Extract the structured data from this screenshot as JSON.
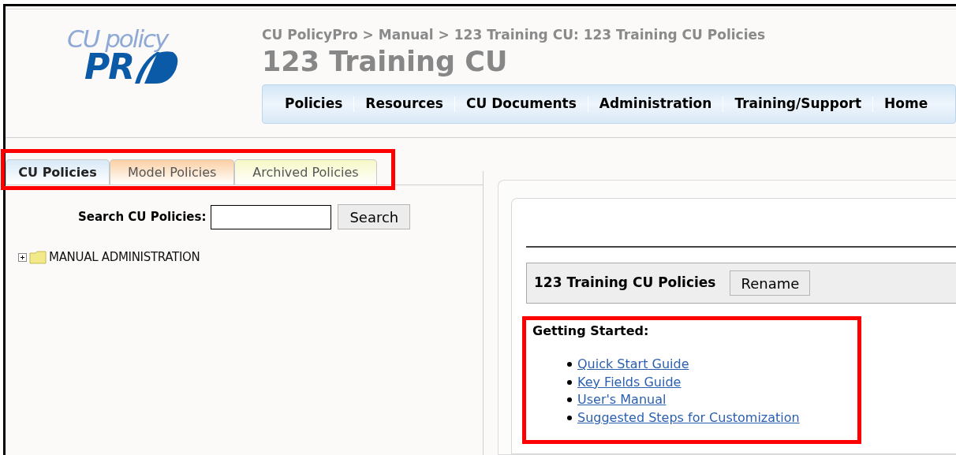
{
  "logo": {
    "top": "CU policy",
    "bottom": "PR"
  },
  "breadcrumb": "CU PolicyPro > Manual > 123 Training CU: 123 Training CU Policies",
  "title": "123 Training CU",
  "nav": [
    "Policies",
    "Resources",
    "CU Documents",
    "Administration",
    "Training/Support",
    "Home"
  ],
  "tabs_highlighted": true,
  "tabs": [
    {
      "label": "CU Policies",
      "selected": true,
      "color": "#d9e9f7"
    },
    {
      "label": "Model Policies",
      "selected": false,
      "color": "#fbd0a4"
    },
    {
      "label": "Archived Policies",
      "selected": false,
      "color": "#f7f8c6"
    }
  ],
  "search": {
    "label": "Search CU Policies:",
    "button": "Search"
  },
  "tree": [
    {
      "label": "MANUAL ADMINISTRATION",
      "expanded": false
    }
  ],
  "folder": {
    "name": "123 Training CU Policies",
    "button": "Rename"
  },
  "getting_started": {
    "highlighted": true,
    "heading": "Getting Started:",
    "links": [
      "Quick Start Guide",
      "Key Fields Guide",
      "User's Manual",
      "Suggested Steps for Customization"
    ]
  }
}
